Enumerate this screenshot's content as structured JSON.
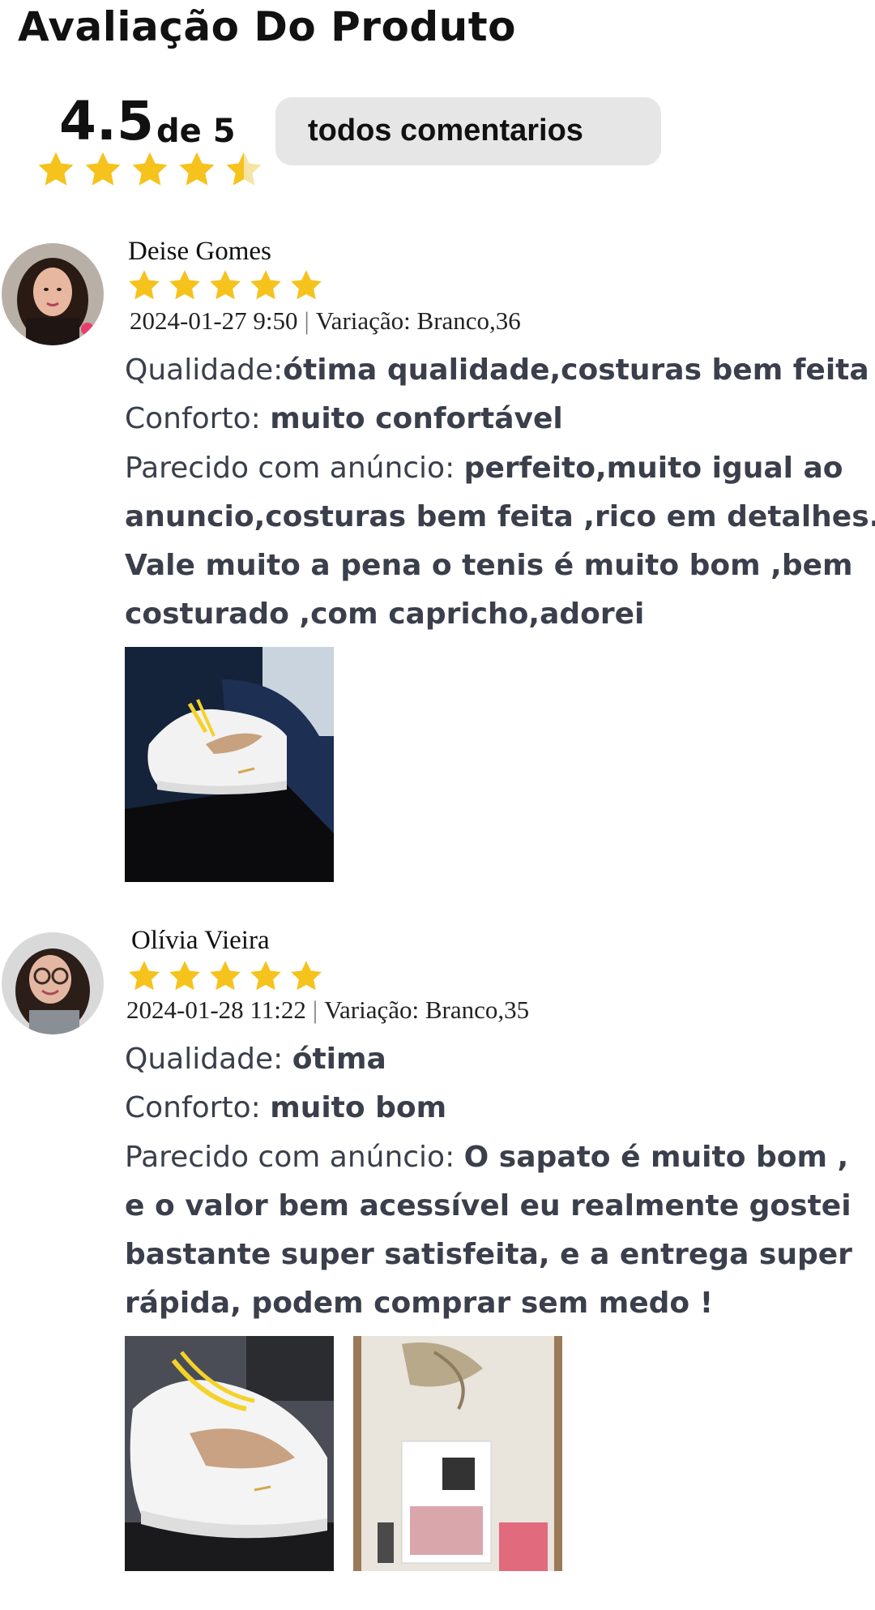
{
  "page": {
    "title": "Avaliação Do Produto"
  },
  "summary": {
    "score": "4.5",
    "of_label": "de 5",
    "rating": 4.5,
    "max_rating": 5,
    "all_comments_label": "todos comentarios"
  },
  "colors": {
    "star": "#f6c21c",
    "star_empty": "#f7e3a4",
    "button_bg": "#e6e6e6",
    "body_text": "#3a3f4b"
  },
  "reviews": [
    {
      "name": "Deise Gomes",
      "rating": 5,
      "date": "2024-01-27 9:50",
      "variation": "Variação: Branco,36",
      "quality_label": "Qualidade:",
      "quality_value": "ótima qualidade,costuras bem feita",
      "comfort_label": "Conforto:",
      "comfort_value": "muito confortável",
      "similar_label": "Parecido com anúncio:",
      "similar_lines": [
        "perfeito,muito igual ao",
        "anuncio,costuras bem feita ,rico em detalhes.",
        "Vale muito a pena o tenis é muito bom ,bem",
        "costurado ,com capricho,adorei"
      ],
      "photos": [
        "sneaker-photo"
      ]
    },
    {
      "name": "Olívia Vieira",
      "rating": 5,
      "date": "2024-01-28 11:22",
      "variation": "Variação: Branco,35",
      "quality_label": "Qualidade:",
      "quality_value": "ótima",
      "comfort_label": "Conforto:",
      "comfort_value": "muito bom",
      "similar_label": "Parecido com anúncio:",
      "similar_lines": [
        "O sapato é muito bom ,",
        "e o valor bem acessível eu realmente gostei",
        "bastante super satisfeita, e a entrega super",
        "rápida, podem comprar sem medo !"
      ],
      "photos": [
        "sneaker-photo",
        "package-photo"
      ]
    }
  ]
}
